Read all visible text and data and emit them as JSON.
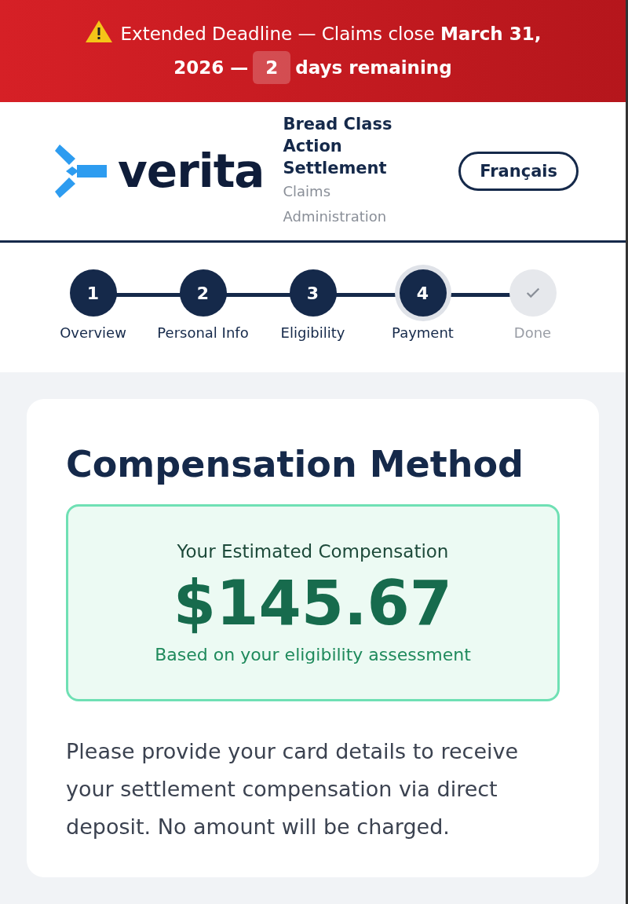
{
  "banner": {
    "line1": "Extended Deadline — Claims close **March 31,**",
    "line2": "2026 —",
    "days": "2",
    "suffix": "days remaining"
  },
  "header": {
    "logo_text": "verita",
    "title": "Bread Class Action Settlement",
    "subtitle": "Claims Administration",
    "language_button": "Français"
  },
  "steps": [
    {
      "label": "Overview",
      "marker": "1",
      "completed": true,
      "selected": false
    },
    {
      "label": "Personal Info",
      "marker": "2",
      "completed": true,
      "selected": false
    },
    {
      "label": "Eligibility",
      "marker": "3",
      "completed": true,
      "selected": false
    },
    {
      "label": "Payment",
      "marker": "4",
      "completed": true,
      "selected": true
    },
    {
      "label": "Done",
      "completed": false,
      "selected": false
    }
  ],
  "card": {
    "title": "Compensation Method",
    "estimate": {
      "label": "Your Estimated Compensation",
      "amount": "$145.67",
      "note": "Based on your eligibility assessment"
    },
    "instructions": "Please provide your card details to receive your settlement compensation via direct deposit. No amount will be charged."
  }
}
